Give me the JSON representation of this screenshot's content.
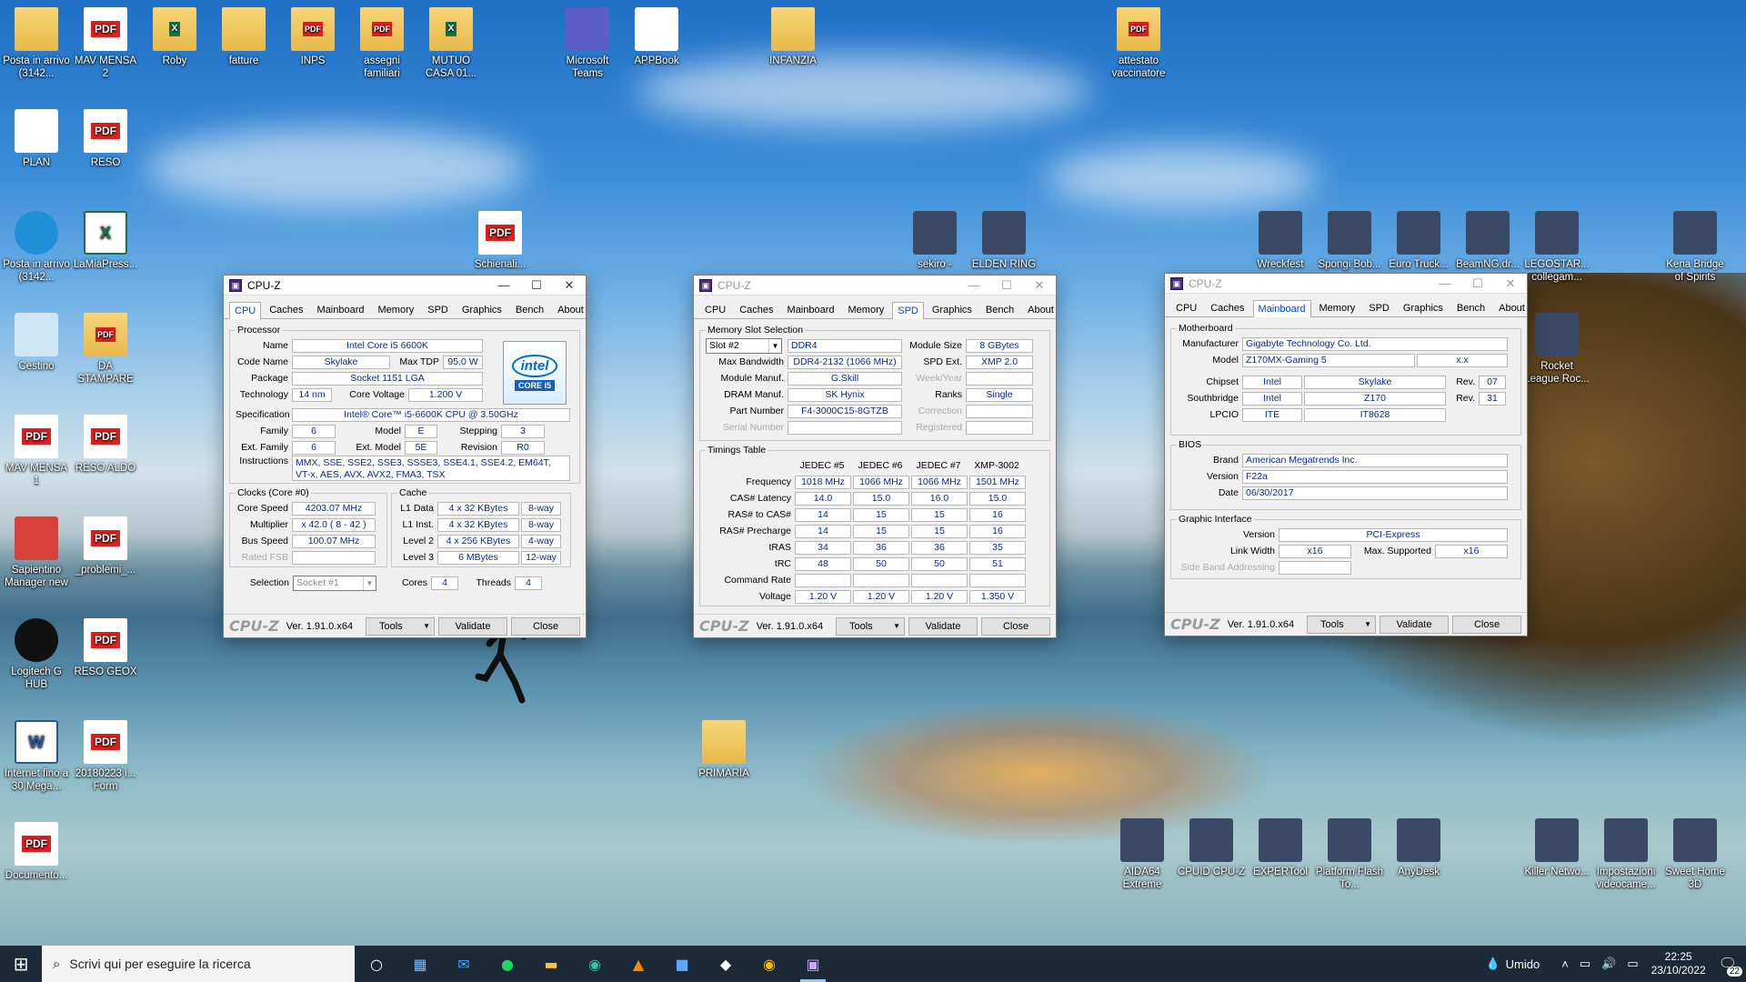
{
  "desktop": {
    "icons_left": [
      {
        "label": "Posta in arrivo (3142...",
        "icon": "mail-folder-icon"
      },
      {
        "label": "MAV MENSA 2",
        "icon": "pdf-icon"
      },
      {
        "label": "Roby",
        "icon": "excel-folder-icon"
      },
      {
        "label": "fatture",
        "icon": "folder-icon"
      },
      {
        "label": "INPS",
        "icon": "pdf-folder-icon"
      },
      {
        "label": "assegni familiari",
        "icon": "pdf-folder-icon"
      },
      {
        "label": "MUTUO CASA 01...",
        "icon": "excel-folder-icon"
      },
      {
        "label": "Microsoft Teams",
        "icon": "teams-icon"
      },
      {
        "label": "APPBook",
        "icon": "appbook-icon"
      },
      {
        "label": "INFANZIA",
        "icon": "folder-icon"
      },
      {
        "label": "attestato vaccinatore",
        "icon": "pdf-folder-icon"
      },
      {
        "label": "PLAN",
        "icon": "document-icon"
      },
      {
        "label": "RESO",
        "icon": "pdf-icon"
      },
      {
        "label": "Posta in arrivo (3142...",
        "icon": "edge-icon"
      },
      {
        "label": "LaMiaPress...",
        "icon": "excel-icon"
      },
      {
        "label": "Schienali...",
        "icon": "pdf-icon"
      },
      {
        "label": "Cestino",
        "icon": "recycle-bin-icon"
      },
      {
        "label": "DA STAMPARE",
        "icon": "pdf-folder-icon"
      },
      {
        "label": "MAV MENSA 1",
        "icon": "pdf-icon"
      },
      {
        "label": "RESO ALDO",
        "icon": "pdf-icon"
      },
      {
        "label": "Sapientino Manager new",
        "icon": "sapientino-icon"
      },
      {
        "label": "_problemi_...",
        "icon": "pdf-icon"
      },
      {
        "label": "Logitech G HUB",
        "icon": "logitech-icon"
      },
      {
        "label": "RESO GEOX",
        "icon": "pdf-icon"
      },
      {
        "label": "Internet fino a 30 Mega...",
        "icon": "word-icon"
      },
      {
        "label": "20180223 i... Form",
        "icon": "pdf-icon"
      },
      {
        "label": "Documento...",
        "icon": "pdf-icon"
      },
      {
        "label": "PRIMARIA",
        "icon": "folder-icon"
      }
    ],
    "icons_games": [
      {
        "label": "sekiro -",
        "icon": "sekiro-icon"
      },
      {
        "label": "ELDEN RING",
        "icon": "elden-ring-icon"
      },
      {
        "label": "Wreckfest",
        "icon": "wreckfest-icon"
      },
      {
        "label": "Spongi Bob...",
        "icon": "spongebob-icon"
      },
      {
        "label": "Euro Truck...",
        "icon": "eurotruck-icon"
      },
      {
        "label": "BeamNG.dr...",
        "icon": "beamng-icon"
      },
      {
        "label": "LEGOSTAR... collegam...",
        "icon": "lego-star-wars-icon"
      },
      {
        "label": "Kena Bridge of Spirits",
        "icon": "kena-icon"
      },
      {
        "label": "Rocket League Roc...",
        "icon": "rocket-league-icon"
      }
    ],
    "icons_bottom": [
      {
        "label": "AIDA64 Extreme",
        "icon": "aida64-icon"
      },
      {
        "label": "CPUID CPU-Z",
        "icon": "cpuz-icon"
      },
      {
        "label": "EXPERTool",
        "icon": "expertool-icon"
      },
      {
        "label": "Platform Flash To...",
        "icon": "intel-flash-icon"
      },
      {
        "label": "AnyDesk",
        "icon": "anydesk-icon"
      },
      {
        "label": "Killer Netwo...",
        "icon": "killer-icon"
      },
      {
        "label": "Impostazioni videocame...",
        "icon": "webcam-icon"
      },
      {
        "label": "Sweet Home 3D",
        "icon": "sweethome-icon"
      }
    ]
  },
  "cpuz": {
    "title": "CPU-Z",
    "tabs": [
      "CPU",
      "Caches",
      "Mainboard",
      "Memory",
      "SPD",
      "Graphics",
      "Bench",
      "About"
    ],
    "brand": "CPU-Z",
    "version": "Ver. 1.91.0.x64",
    "buttons": {
      "tools": "Tools",
      "validate": "Validate",
      "close": "Close"
    }
  },
  "cpu_win": {
    "processor_legend": "Processor",
    "name_lbl": "Name",
    "name": "Intel Core i5 6600K",
    "codename_lbl": "Code Name",
    "codename": "Skylake",
    "maxtdp_lbl": "Max TDP",
    "maxtdp": "95.0 W",
    "package_lbl": "Package",
    "package": "Socket 1151 LGA",
    "tech_lbl": "Technology",
    "tech": "14 nm",
    "corev_lbl": "Core Voltage",
    "corev": "1.200 V",
    "spec_lbl": "Specification",
    "spec": "Intel® Core™ i5-6600K CPU @ 3.50GHz",
    "family_lbl": "Family",
    "family": "6",
    "model_lbl": "Model",
    "model": "E",
    "stepping_lbl": "Stepping",
    "stepping": "3",
    "extfamily_lbl": "Ext. Family",
    "extfamily": "6",
    "extmodel_lbl": "Ext. Model",
    "extmodel": "5E",
    "revision_lbl": "Revision",
    "revision": "R0",
    "instr_lbl": "Instructions",
    "instr": "MMX, SSE, SSE2, SSE3, SSSE3, SSE4.1, SSE4.2, EM64T, VT-x, AES, AVX, AVX2, FMA3, TSX",
    "logo_text": "intel",
    "logo_sub": "CORE i5",
    "clocks_legend": "Clocks (Core #0)",
    "corespeed_lbl": "Core Speed",
    "corespeed": "4203.07 MHz",
    "mult_lbl": "Multiplier",
    "mult": "x 42.0 ( 8 - 42 )",
    "bus_lbl": "Bus Speed",
    "bus": "100.07 MHz",
    "fsb_lbl": "Rated FSB",
    "fsb": "",
    "cache_legend": "Cache",
    "l1d_lbl": "L1 Data",
    "l1d": "4 x 32 KBytes",
    "l1d_way": "8-way",
    "l1i_lbl": "L1 Inst.",
    "l1i": "4 x 32 KBytes",
    "l1i_way": "8-way",
    "l2_lbl": "Level 2",
    "l2": "4 x 256 KBytes",
    "l2_way": "4-way",
    "l3_lbl": "Level 3",
    "l3": "6 MBytes",
    "l3_way": "12-way",
    "selection_lbl": "Selection",
    "selection": "Socket #1",
    "cores_lbl": "Cores",
    "cores": "4",
    "threads_lbl": "Threads",
    "threads": "4"
  },
  "spd_win": {
    "slot_legend": "Memory Slot Selection",
    "slot": "Slot #2",
    "type": "DDR4",
    "modsize_lbl": "Module Size",
    "modsize": "8 GBytes",
    "maxbw_lbl": "Max Bandwidth",
    "maxbw": "DDR4-2132 (1066 MHz)",
    "spdext_lbl": "SPD Ext.",
    "spdext": "XMP 2.0",
    "modmanuf_lbl": "Module Manuf.",
    "modmanuf": "G.Skill",
    "weekyear_lbl": "Week/Year",
    "weekyear": "",
    "drammanuf_lbl": "DRAM Manuf.",
    "drammanuf": "SK Hynix",
    "ranks_lbl": "Ranks",
    "ranks": "Single",
    "partnum_lbl": "Part Number",
    "partnum": "F4-3000C15-8GTZB",
    "correction_lbl": "Correction",
    "correction": "",
    "serial_lbl": "Serial Number",
    "serial": "",
    "registered_lbl": "Registered",
    "registered": "",
    "timings_legend": "Timings Table",
    "cols": [
      "JEDEC #5",
      "JEDEC #6",
      "JEDEC #7",
      "XMP-3002"
    ],
    "rows": [
      {
        "label": "Frequency",
        "vals": [
          "1018 MHz",
          "1066 MHz",
          "1066 MHz",
          "1501 MHz"
        ]
      },
      {
        "label": "CAS# Latency",
        "vals": [
          "14.0",
          "15.0",
          "16.0",
          "15.0"
        ]
      },
      {
        "label": "RAS# to CAS#",
        "vals": [
          "14",
          "15",
          "15",
          "16"
        ]
      },
      {
        "label": "RAS# Precharge",
        "vals": [
          "14",
          "15",
          "15",
          "16"
        ]
      },
      {
        "label": "tRAS",
        "vals": [
          "34",
          "36",
          "36",
          "35"
        ]
      },
      {
        "label": "tRC",
        "vals": [
          "48",
          "50",
          "50",
          "51"
        ]
      },
      {
        "label": "Command Rate",
        "vals": [
          "",
          "",
          "",
          ""
        ]
      },
      {
        "label": "Voltage",
        "vals": [
          "1.20 V",
          "1.20 V",
          "1.20 V",
          "1.350 V"
        ]
      }
    ]
  },
  "mb_win": {
    "mb_legend": "Motherboard",
    "manuf_lbl": "Manufacturer",
    "manuf": "Gigabyte Technology Co. Ltd.",
    "model_lbl": "Model",
    "model": "Z170MX-Gaming 5",
    "model_rev": "x.x",
    "chipset_lbl": "Chipset",
    "chipset_v": "Intel",
    "chipset_n": "Skylake",
    "chipset_rev_lbl": "Rev.",
    "chipset_rev": "07",
    "sb_lbl": "Southbridge",
    "sb_v": "Intel",
    "sb_n": "Z170",
    "sb_rev_lbl": "Rev.",
    "sb_rev": "31",
    "lpcio_lbl": "LPCIO",
    "lpcio_v": "ITE",
    "lpcio_n": "IT8628",
    "bios_legend": "BIOS",
    "brand_lbl": "Brand",
    "brand": "American Megatrends Inc.",
    "version_lbl": "Version",
    "version": "F22a",
    "date_lbl": "Date",
    "date": "06/30/2017",
    "gi_legend": "Graphic Interface",
    "giver_lbl": "Version",
    "giver": "PCI-Express",
    "linkw_lbl": "Link Width",
    "linkw": "x16",
    "maxsup_lbl": "Max. Supported",
    "maxsup": "x16",
    "sba_lbl": "Side Band Addressing",
    "sba": ""
  },
  "taskbar": {
    "search_placeholder": "Scrivi qui per eseguire la ricerca",
    "weather": "Umido",
    "time": "22:25",
    "date": "23/10/2022",
    "notifications": "22"
  }
}
